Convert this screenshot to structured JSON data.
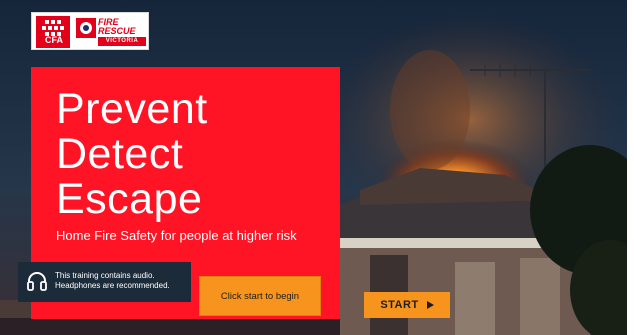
{
  "logos": {
    "cfa": {
      "label": "CFA",
      "icon": "cfa-logo-icon"
    },
    "frv": {
      "line1": "FIRE",
      "line2": "RESCUE",
      "sub": "VICTORIA",
      "icon": "frv-logo-icon"
    }
  },
  "hero": {
    "title_lines": [
      "Prevent",
      "Detect",
      "Escape"
    ],
    "subtitle": "Home Fire Safety for people at higher risk",
    "color": "#ff1426"
  },
  "audio_notice": {
    "icon": "headphones-icon",
    "line1": "This training contains audio.",
    "line2": "Headphones are recommended."
  },
  "begin_prompt": "Click start to begin",
  "start_button": {
    "label": "START",
    "icon": "play-icon",
    "color": "#f7941d"
  },
  "colors": {
    "accent": "#f7941d",
    "brand_red": "#e2001a",
    "navy": "#1c2b3a"
  }
}
